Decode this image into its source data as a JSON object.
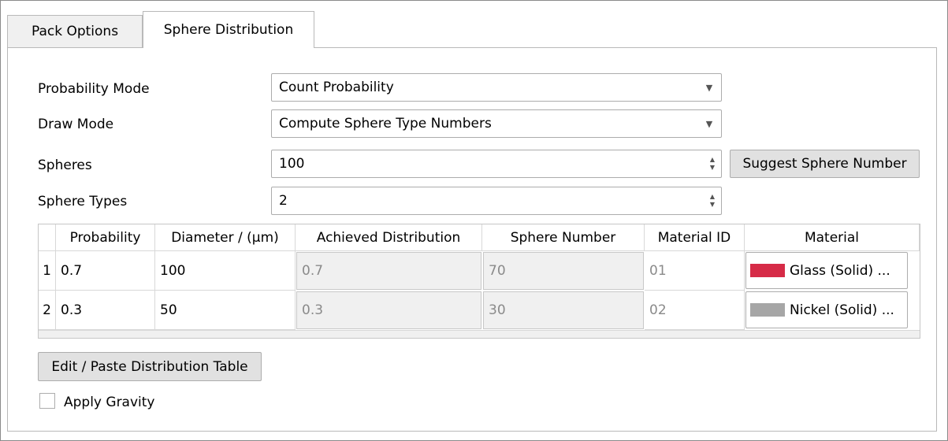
{
  "tabs": [
    {
      "label": "Pack Options",
      "active": false
    },
    {
      "label": "Sphere Distribution",
      "active": true
    }
  ],
  "form": {
    "probability_mode": {
      "label": "Probability Mode",
      "value": "Count Probability"
    },
    "draw_mode": {
      "label": "Draw Mode",
      "value": "Compute Sphere Type Numbers"
    },
    "spheres": {
      "label": "Spheres",
      "value": "100"
    },
    "sphere_types": {
      "label": "Sphere Types",
      "value": "2"
    },
    "suggest_button": "Suggest Sphere Number"
  },
  "table": {
    "columns": [
      "Probability",
      "Diameter / (µm)",
      "Achieved Distribution",
      "Sphere Number",
      "Material ID",
      "Material"
    ],
    "rows": [
      {
        "index": "1",
        "probability": "0.7",
        "diameter": "100",
        "achieved": "0.7",
        "sphere_number": "70",
        "material_id": "01",
        "material": "Glass (Solid) ...",
        "material_color": "#d62b47"
      },
      {
        "index": "2",
        "probability": "0.3",
        "diameter": "50",
        "achieved": "0.3",
        "sphere_number": "30",
        "material_id": "02",
        "material": "Nickel (Solid) ...",
        "material_color": "#a6a6a6"
      }
    ]
  },
  "edit_button": "Edit / Paste Distribution Table",
  "gravity": {
    "label": "Apply Gravity",
    "checked": false
  }
}
